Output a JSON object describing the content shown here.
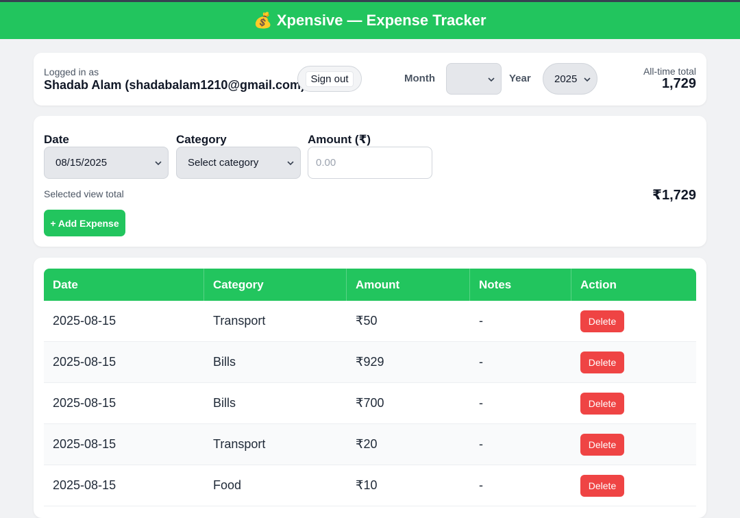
{
  "header": {
    "emoji": "💰",
    "title": "Xpensive — Expense Tracker"
  },
  "user": {
    "logged_label": "Logged in as",
    "name": "Shadab Alam (shadabalam1210@gmail.com)",
    "signout_label": "Sign out"
  },
  "filters": {
    "month_label": "Month",
    "month_value": "",
    "year_label": "Year",
    "year_value": "2025",
    "alltime_label": "All-time total",
    "alltime_value": "1,729"
  },
  "form": {
    "date_label": "Date",
    "date_value": "08/15/2025",
    "category_label": "Category",
    "category_value": "Select category",
    "amount_label": "Amount (₹)",
    "amount_placeholder": "0.00",
    "view_total_label": "Selected view total",
    "view_total_value": "₹1,729",
    "add_label": "+ Add Expense"
  },
  "table": {
    "columns": [
      "Date",
      "Category",
      "Amount",
      "Notes",
      "Action"
    ],
    "rows": [
      {
        "date": "2025-08-15",
        "category": "Transport",
        "amount": "₹50",
        "notes": "-",
        "action": "Delete"
      },
      {
        "date": "2025-08-15",
        "category": "Bills",
        "amount": "₹929",
        "notes": "-",
        "action": "Delete"
      },
      {
        "date": "2025-08-15",
        "category": "Bills",
        "amount": "₹700",
        "notes": "-",
        "action": "Delete"
      },
      {
        "date": "2025-08-15",
        "category": "Transport",
        "amount": "₹20",
        "notes": "-",
        "action": "Delete"
      },
      {
        "date": "2025-08-15",
        "category": "Food",
        "amount": "₹10",
        "notes": "-",
        "action": "Delete"
      }
    ]
  },
  "colors": {
    "accent": "#22c55e",
    "danger": "#ef4444",
    "background": "#f1f2f4"
  }
}
